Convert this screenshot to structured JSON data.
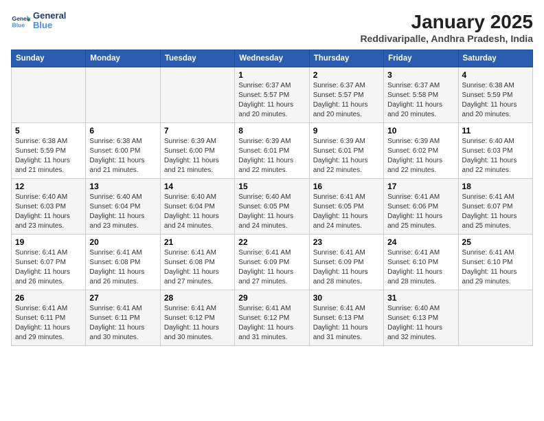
{
  "logo": {
    "line1": "General",
    "line2": "Blue"
  },
  "title": "January 2025",
  "subtitle": "Reddivaripalle, Andhra Pradesh, India",
  "weekdays": [
    "Sunday",
    "Monday",
    "Tuesday",
    "Wednesday",
    "Thursday",
    "Friday",
    "Saturday"
  ],
  "weeks": [
    [
      {
        "day": "",
        "info": ""
      },
      {
        "day": "",
        "info": ""
      },
      {
        "day": "",
        "info": ""
      },
      {
        "day": "1",
        "info": "Sunrise: 6:37 AM\nSunset: 5:57 PM\nDaylight: 11 hours and 20 minutes."
      },
      {
        "day": "2",
        "info": "Sunrise: 6:37 AM\nSunset: 5:57 PM\nDaylight: 11 hours and 20 minutes."
      },
      {
        "day": "3",
        "info": "Sunrise: 6:37 AM\nSunset: 5:58 PM\nDaylight: 11 hours and 20 minutes."
      },
      {
        "day": "4",
        "info": "Sunrise: 6:38 AM\nSunset: 5:59 PM\nDaylight: 11 hours and 20 minutes."
      }
    ],
    [
      {
        "day": "5",
        "info": "Sunrise: 6:38 AM\nSunset: 5:59 PM\nDaylight: 11 hours and 21 minutes."
      },
      {
        "day": "6",
        "info": "Sunrise: 6:38 AM\nSunset: 6:00 PM\nDaylight: 11 hours and 21 minutes."
      },
      {
        "day": "7",
        "info": "Sunrise: 6:39 AM\nSunset: 6:00 PM\nDaylight: 11 hours and 21 minutes."
      },
      {
        "day": "8",
        "info": "Sunrise: 6:39 AM\nSunset: 6:01 PM\nDaylight: 11 hours and 22 minutes."
      },
      {
        "day": "9",
        "info": "Sunrise: 6:39 AM\nSunset: 6:01 PM\nDaylight: 11 hours and 22 minutes."
      },
      {
        "day": "10",
        "info": "Sunrise: 6:39 AM\nSunset: 6:02 PM\nDaylight: 11 hours and 22 minutes."
      },
      {
        "day": "11",
        "info": "Sunrise: 6:40 AM\nSunset: 6:03 PM\nDaylight: 11 hours and 22 minutes."
      }
    ],
    [
      {
        "day": "12",
        "info": "Sunrise: 6:40 AM\nSunset: 6:03 PM\nDaylight: 11 hours and 23 minutes."
      },
      {
        "day": "13",
        "info": "Sunrise: 6:40 AM\nSunset: 6:04 PM\nDaylight: 11 hours and 23 minutes."
      },
      {
        "day": "14",
        "info": "Sunrise: 6:40 AM\nSunset: 6:04 PM\nDaylight: 11 hours and 24 minutes."
      },
      {
        "day": "15",
        "info": "Sunrise: 6:40 AM\nSunset: 6:05 PM\nDaylight: 11 hours and 24 minutes."
      },
      {
        "day": "16",
        "info": "Sunrise: 6:41 AM\nSunset: 6:05 PM\nDaylight: 11 hours and 24 minutes."
      },
      {
        "day": "17",
        "info": "Sunrise: 6:41 AM\nSunset: 6:06 PM\nDaylight: 11 hours and 25 minutes."
      },
      {
        "day": "18",
        "info": "Sunrise: 6:41 AM\nSunset: 6:07 PM\nDaylight: 11 hours and 25 minutes."
      }
    ],
    [
      {
        "day": "19",
        "info": "Sunrise: 6:41 AM\nSunset: 6:07 PM\nDaylight: 11 hours and 26 minutes."
      },
      {
        "day": "20",
        "info": "Sunrise: 6:41 AM\nSunset: 6:08 PM\nDaylight: 11 hours and 26 minutes."
      },
      {
        "day": "21",
        "info": "Sunrise: 6:41 AM\nSunset: 6:08 PM\nDaylight: 11 hours and 27 minutes."
      },
      {
        "day": "22",
        "info": "Sunrise: 6:41 AM\nSunset: 6:09 PM\nDaylight: 11 hours and 27 minutes."
      },
      {
        "day": "23",
        "info": "Sunrise: 6:41 AM\nSunset: 6:09 PM\nDaylight: 11 hours and 28 minutes."
      },
      {
        "day": "24",
        "info": "Sunrise: 6:41 AM\nSunset: 6:10 PM\nDaylight: 11 hours and 28 minutes."
      },
      {
        "day": "25",
        "info": "Sunrise: 6:41 AM\nSunset: 6:10 PM\nDaylight: 11 hours and 29 minutes."
      }
    ],
    [
      {
        "day": "26",
        "info": "Sunrise: 6:41 AM\nSunset: 6:11 PM\nDaylight: 11 hours and 29 minutes."
      },
      {
        "day": "27",
        "info": "Sunrise: 6:41 AM\nSunset: 6:11 PM\nDaylight: 11 hours and 30 minutes."
      },
      {
        "day": "28",
        "info": "Sunrise: 6:41 AM\nSunset: 6:12 PM\nDaylight: 11 hours and 30 minutes."
      },
      {
        "day": "29",
        "info": "Sunrise: 6:41 AM\nSunset: 6:12 PM\nDaylight: 11 hours and 31 minutes."
      },
      {
        "day": "30",
        "info": "Sunrise: 6:41 AM\nSunset: 6:13 PM\nDaylight: 11 hours and 31 minutes."
      },
      {
        "day": "31",
        "info": "Sunrise: 6:40 AM\nSunset: 6:13 PM\nDaylight: 11 hours and 32 minutes."
      },
      {
        "day": "",
        "info": ""
      }
    ]
  ]
}
